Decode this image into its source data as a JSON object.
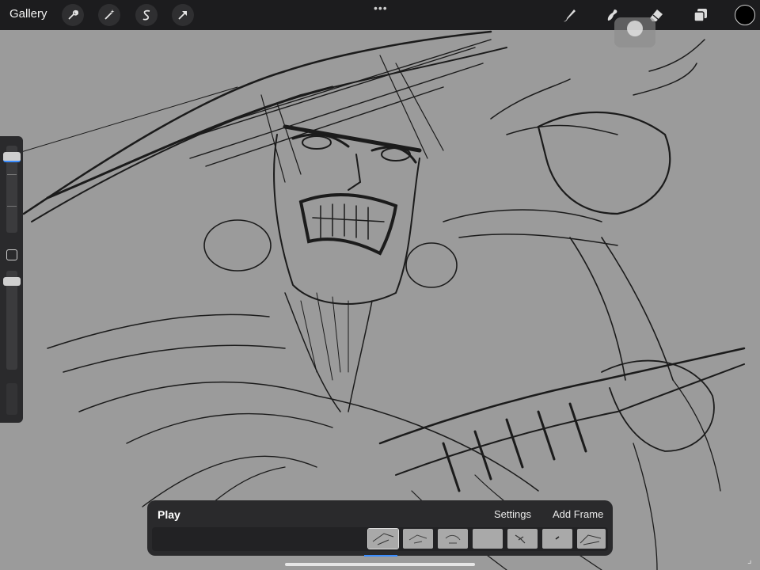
{
  "app": {
    "gallery_label": "Gallery",
    "top_icons": [
      "wrench-icon",
      "magic-wand-icon",
      "selection-s-icon",
      "transform-arrow-icon"
    ],
    "more_dots": "•••",
    "right_tools": [
      "brush-icon",
      "smudge-icon",
      "eraser-icon",
      "layers-icon"
    ],
    "current_color": "#000000"
  },
  "animation_assist": {
    "play_label": "Play",
    "settings_label": "Settings",
    "add_frame_label": "Add Frame",
    "frame_count": 7,
    "selected_frame": 1
  },
  "colors": {
    "canvas": "#9b9b9b",
    "toolbar": "#1c1c1e",
    "accent": "#3a8dff"
  }
}
